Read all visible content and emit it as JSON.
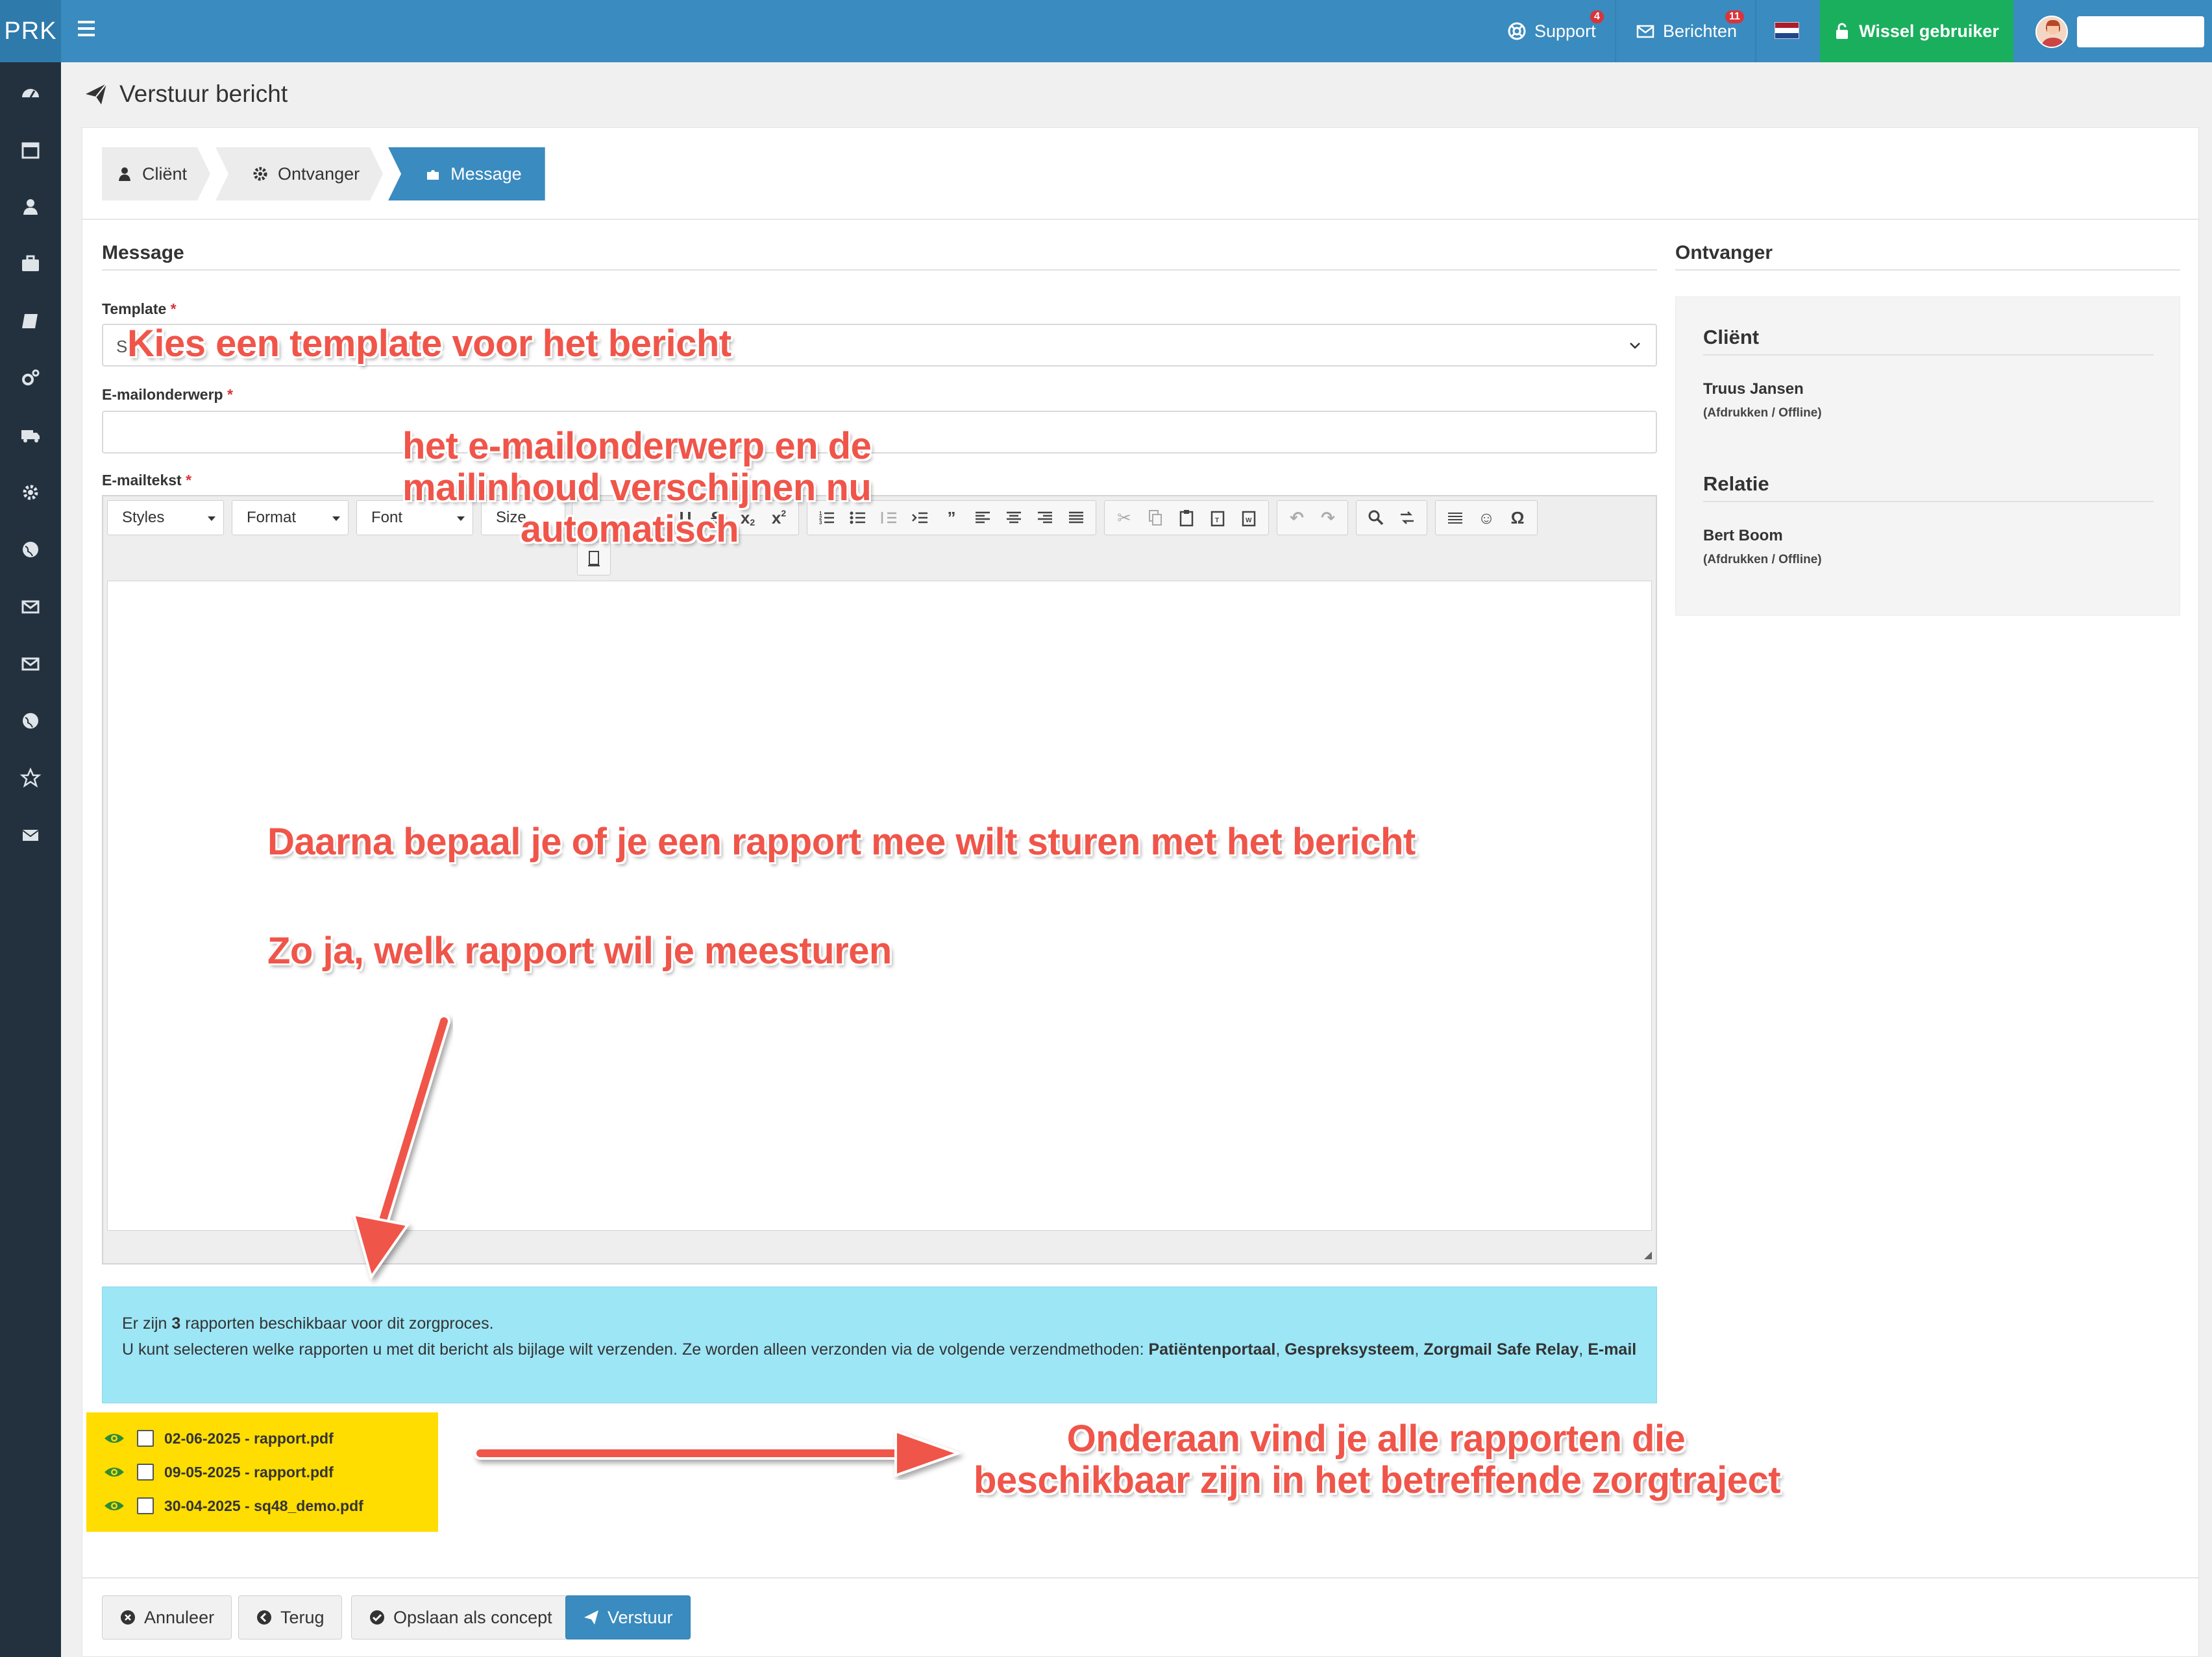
{
  "app": {
    "brand": "PRK"
  },
  "topbar": {
    "support_label": "Support",
    "support_badge": "4",
    "messages_label": "Berichten",
    "messages_badge": "11",
    "language_flag": "nl-flag",
    "switch_user_label": "Wissel gebruiker",
    "user_name": ""
  },
  "sidebar": {
    "items": [
      "dashboard-icon",
      "calendar-icon",
      "user-icon",
      "briefcase-icon",
      "book-icon",
      "cogs-icon",
      "truck-icon",
      "gear-icon",
      "globe-icon",
      "envelope-open-icon",
      "envelope-icon",
      "globe-icon",
      "star-icon",
      "envelope-filled-icon"
    ]
  },
  "page": {
    "title": "Verstuur bericht"
  },
  "wizard": {
    "steps": [
      {
        "label": "Cliënt",
        "icon": "user-icon",
        "active": false
      },
      {
        "label": "Ontvanger",
        "icon": "gear-icon",
        "active": false
      },
      {
        "label": "Message",
        "icon": "puzzle-icon",
        "active": true
      }
    ]
  },
  "form": {
    "section_title": "Message",
    "template_label": "Template",
    "template_value": "S",
    "subject_label": "E-mailonderwerp",
    "subject_value": "",
    "body_label": "E-mailtekst",
    "required_marker": "*",
    "toolbar": {
      "styles": "Styles",
      "format": "Format",
      "font": "Font",
      "size": "Size"
    }
  },
  "info": {
    "prefix": "Er zijn ",
    "count": "3",
    "suffix": " rapporten beschikbaar voor dit zorgproces.",
    "line2_prefix": "U kunt selecteren welke rapporten u met dit bericht als bijlage wilt verzenden. Ze worden alleen verzonden via de volgende verzendmethoden: ",
    "method1": "Patiëntenportaal",
    "method2": "Gespreksysteem",
    "method3": "Zorgmail Safe Relay",
    "method4": "E-mail",
    "sep": ", "
  },
  "reports": [
    {
      "label": "02-06-2025 - rapport.pdf",
      "checked": false
    },
    {
      "label": "09-05-2025 - rapport.pdf",
      "checked": false
    },
    {
      "label": "30-04-2025 - sq48_demo.pdf",
      "checked": false
    }
  ],
  "recipient": {
    "section_title": "Ontvanger",
    "client_heading": "Cliënt",
    "client_name": "Truus Jansen",
    "client_status": "(Afdrukken / Offline)",
    "relation_heading": "Relatie",
    "relation_name": "Bert Boom",
    "relation_status": "(Afdrukken / Offline)"
  },
  "buttons": {
    "cancel": "Annuleer",
    "back": "Terug",
    "save_draft": "Opslaan als concept",
    "send": "Verstuur"
  },
  "annotations": {
    "template": "Kies een template voor het bericht",
    "auto_line1": "het e-mailonderwerp en de",
    "auto_line2": "mailinhoud verschijnen nu",
    "auto_line3": "automatisch",
    "report_q": "Daarna bepaal je of je een rapport mee wilt sturen met het bericht",
    "report_which": "Zo ja, welk rapport wil je meesturen",
    "bottom_line1": "Onderaan vind je alle rapporten die",
    "bottom_line2": "beschikbaar zijn in het betreffende zorgtraject"
  },
  "colors": {
    "topbar": "#3a8bbf",
    "sidebar": "#23313f",
    "switch_user": "#1aaf5d",
    "info_box": "#9de6f6",
    "highlight": "#ffdd00",
    "annotation": "#f0554a"
  }
}
